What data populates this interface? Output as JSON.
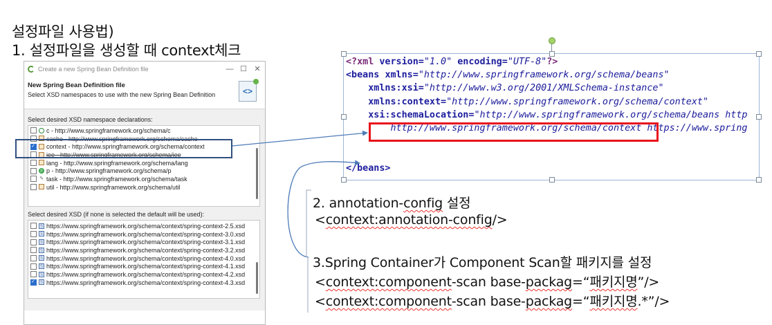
{
  "heading": {
    "line1": "설정파일 사용법)",
    "line2": "1. 설정파일을 생성할 때 context체크"
  },
  "dialog": {
    "window_title": "Create a new Spring Bean Definition file",
    "minimize_glyph": "—",
    "maximize_glyph": "☐",
    "close_glyph": "✕",
    "header_title": "New Spring Bean Definition file",
    "header_desc": "Select XSD namespaces to use with the new Spring Bean Definition",
    "header_icon_text": "<>",
    "namespace_label": "Select desired XSD namespace declarations:",
    "namespaces": [
      {
        "icon": "c-namespace-icon",
        "text": "c - http://www.springframework.org/schema/c",
        "checked": false
      },
      {
        "icon": "cache-file-icon",
        "text": "cache - http://www.springframework.org/schema/cache",
        "checked": false
      },
      {
        "icon": "context-file-icon",
        "text": "context - http://www.springframework.org/schema/context",
        "checked": true
      },
      {
        "icon": "jee-file-icon",
        "text": "jee - http://www.springframework.org/schema/jee",
        "checked": false
      },
      {
        "icon": "lang-file-icon",
        "text": "lang - http://www.springframework.org/schema/lang",
        "checked": false
      },
      {
        "icon": "p-namespace-icon",
        "text": "p - http://www.springframework.org/schema/p",
        "checked": false
      },
      {
        "icon": "task-icon",
        "text": "task - http://www.springframework.org/schema/task",
        "checked": false
      },
      {
        "icon": "util-file-icon",
        "text": "util - http://www.springframework.org/schema/util",
        "checked": false
      }
    ],
    "xsd_label": "Select desired XSD (if none is selected the default will be used):",
    "xsds": [
      {
        "text": "https://www.springframework.org/schema/context/spring-context-2.5.xsd",
        "checked": false
      },
      {
        "text": "https://www.springframework.org/schema/context/spring-context-3.0.xsd",
        "checked": false
      },
      {
        "text": "https://www.springframework.org/schema/context/spring-context-3.1.xsd",
        "checked": false
      },
      {
        "text": "https://www.springframework.org/schema/context/spring-context-3.2.xsd",
        "checked": false
      },
      {
        "text": "https://www.springframework.org/schema/context/spring-context-4.0.xsd",
        "checked": false
      },
      {
        "text": "https://www.springframework.org/schema/context/spring-context-4.1.xsd",
        "checked": false
      },
      {
        "text": "https://www.springframework.org/schema/context/spring-context-4.2.xsd",
        "checked": false
      },
      {
        "text": "https://www.springframework.org/schema/context/spring-context-4.3.xsd",
        "checked": true
      }
    ]
  },
  "xml": {
    "decl_open": "<?xml ",
    "decl_version_attr": "version=",
    "decl_version_val": "\"1.0\"",
    "decl_encoding_attr": " encoding=",
    "decl_encoding_val": "\"UTF-8\"",
    "decl_close": "?>",
    "beans_open": "<beans ",
    "xmlns_attr": "xmlns=",
    "xmlns_val": "\"http://www.springframework.org/schema/beans\"",
    "xsi_attr": "xmlns:xsi=",
    "xsi_val": "\"http://www.w3.org/2001/XMLSchema-instance\"",
    "context_attr": "xmlns:context=",
    "context_val": "\"http://www.springframework.org/schema/context\"",
    "schema_attr": "xsi:schemaLocation=",
    "schema_val": "\"http://www.springframework.org/schema/beans http",
    "schema_line2_val": "http://www.springframework.org/schema/context",
    "schema_line2_rest": " https://www.spring",
    "beans_close": "</beans>"
  },
  "annotations": {
    "step2_title_pre": "2. annotation-",
    "step2_title_sq": "config",
    "step2_title_post": " 설정",
    "step2_code_lt": " <",
    "step2_code_sq": "context:annotation-config",
    "step2_code_end": "/>",
    "step3_title_pre": "3.Spring Container가 Component Scan할 패키지를 설정",
    "step3_line1_lt": " <",
    "step3_line1_sq1": "context:component",
    "step3_line1_mid": "-scan base-",
    "step3_line1_sq2": "packag",
    "step3_line1_eq": "=“",
    "step3_line1_sq3": "패키지명",
    "step3_line1_end": "”/>",
    "step3_line2_lt": " <",
    "step3_line2_sq1": "context:component",
    "step3_line2_mid": "-scan base-",
    "step3_line2_sq2": "packag",
    "step3_line2_eq": "=“",
    "step3_line2_sq3": "패키지명",
    "step3_line2_end": ".*”/>"
  },
  "colors": {
    "highlight_red": "#e8131c",
    "highlight_blue": "#2f4f80",
    "arrow_blue": "#4d7ab8",
    "code_border": "#9eb3d6"
  }
}
